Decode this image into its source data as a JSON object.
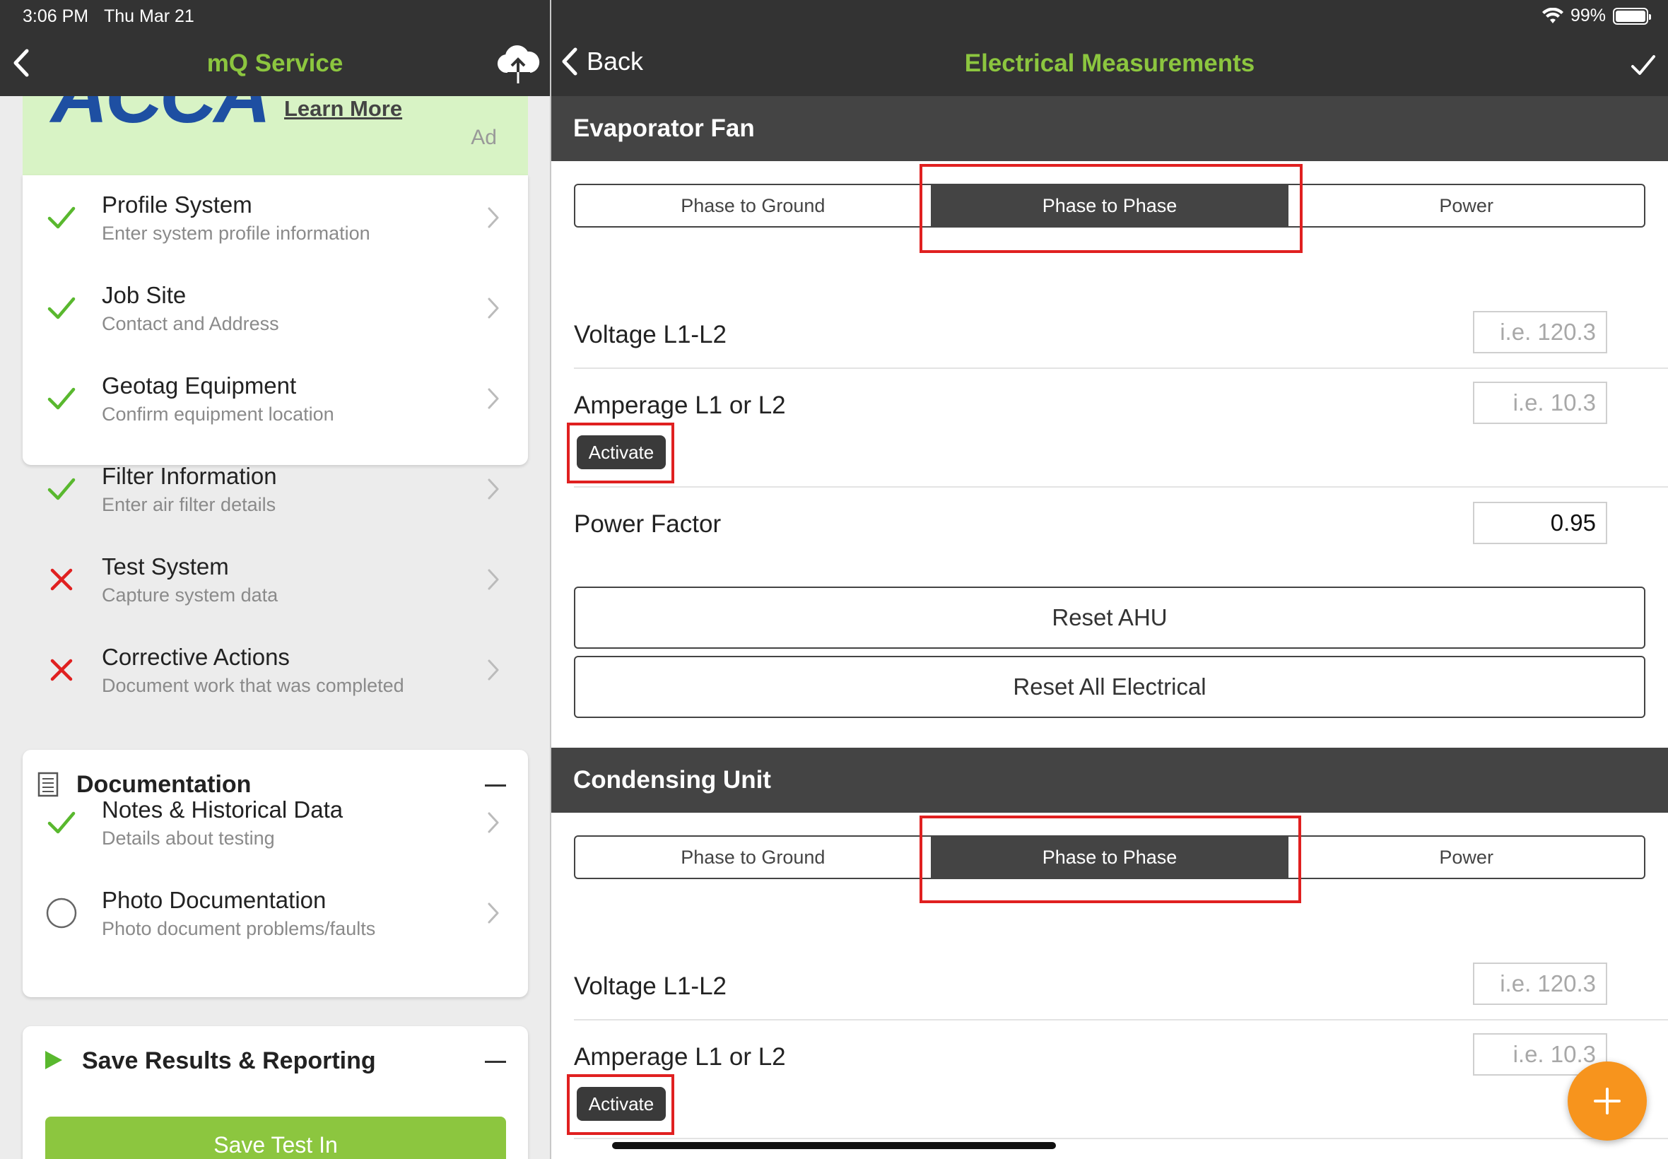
{
  "status": {
    "time": "3:06 PM",
    "date": "Thu Mar 21",
    "battery": "99%"
  },
  "left": {
    "title": "mQ Service",
    "ad": {
      "logo": "ACCA",
      "link": "Learn More",
      "label": "Ad"
    },
    "tasks": [
      {
        "title": "Profile System",
        "subtitle": "Enter system profile information",
        "status": "done"
      },
      {
        "title": "Job Site",
        "subtitle": "Contact and Address",
        "status": "done"
      },
      {
        "title": "Geotag Equipment",
        "subtitle": "Confirm equipment location",
        "status": "done"
      },
      {
        "title": "Filter Information",
        "subtitle": "Enter air filter details",
        "status": "done"
      },
      {
        "title": "Test System",
        "subtitle": "Capture system data",
        "status": "failed"
      },
      {
        "title": "Corrective Actions",
        "subtitle": "Document work that was completed",
        "status": "failed"
      }
    ],
    "documentation": {
      "title": "Documentation",
      "items": [
        {
          "title": "Notes & Historical Data",
          "subtitle": "Details about testing",
          "status": "done"
        },
        {
          "title": "Photo Documentation",
          "subtitle": "Photo document problems/faults",
          "status": "pending"
        }
      ]
    },
    "save": {
      "title": "Save Results & Reporting",
      "button": "Save Test In"
    }
  },
  "right": {
    "back_label": "Back",
    "title": "Electrical Measurements",
    "evaporator": {
      "title": "Evaporator Fan",
      "tabs": [
        "Phase to Ground",
        "Phase to Phase",
        "Power"
      ],
      "selected_tab": "Phase to Phase",
      "voltage_label": "Voltage L1-L2",
      "voltage_placeholder": "i.e. 120.3",
      "amperage_label": "Amperage L1 or L2",
      "amperage_placeholder": "i.e. 10.3",
      "activate_label": "Activate",
      "power_factor_label": "Power Factor",
      "power_factor_value": "0.95",
      "reset_ahu": "Reset AHU",
      "reset_all": "Reset All Electrical"
    },
    "condensing": {
      "title": "Condensing Unit",
      "tabs": [
        "Phase to Ground",
        "Phase to Phase",
        "Power"
      ],
      "selected_tab": "Phase to Phase",
      "voltage_label": "Voltage L1-L2",
      "voltage_placeholder": "i.e. 120.3",
      "amperage_label": "Amperage L1 or L2",
      "amperage_placeholder": "i.e. 10.3",
      "activate_label": "Activate"
    }
  },
  "colors": {
    "brand_green": "#8cc63f",
    "header_dark": "#333333",
    "band_dark": "#444444",
    "success": "#59b82e",
    "error": "#e02020",
    "highlight": "#e02020",
    "fab": "#f7941d"
  }
}
